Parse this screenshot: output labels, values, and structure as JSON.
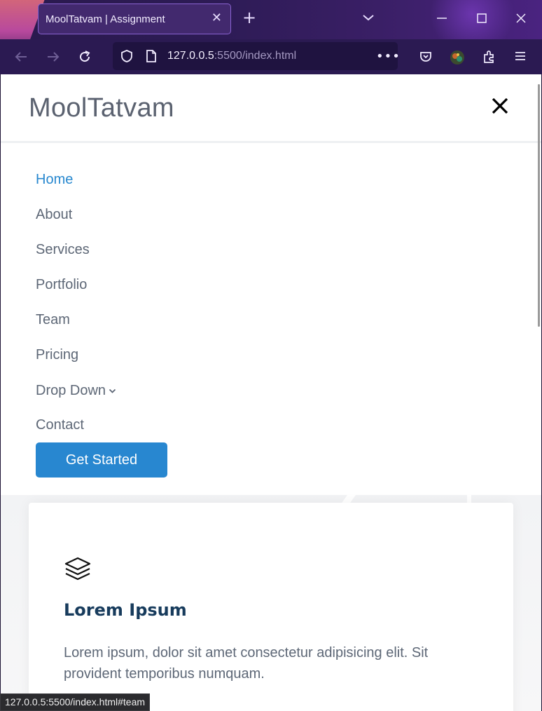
{
  "browser": {
    "tab_title": "MoolTatvam | Assignment",
    "url_host": "127.0.0.5",
    "url_rest": ":5500/index.html",
    "status_url": "127.0.0.5:5500/index.html#team"
  },
  "site": {
    "logo": "MoolTatvam",
    "nav": [
      {
        "label": "Home",
        "active": true
      },
      {
        "label": "About"
      },
      {
        "label": "Services"
      },
      {
        "label": "Portfolio"
      },
      {
        "label": "Team"
      },
      {
        "label": "Pricing"
      },
      {
        "label": "Drop Down",
        "has_dropdown": true
      },
      {
        "label": "Contact"
      }
    ],
    "cta": "Get Started",
    "card": {
      "icon": "layers-icon",
      "title": "Lorem Ipsum",
      "text": "Lorem ipsum, dolor sit amet consectetur adipisicing elit. Sit provident temporibus numquam."
    }
  },
  "colors": {
    "accent": "#2887d0",
    "nav_text": "#5d6776",
    "active_nav": "#2888cf",
    "card_title": "#173b5c"
  }
}
